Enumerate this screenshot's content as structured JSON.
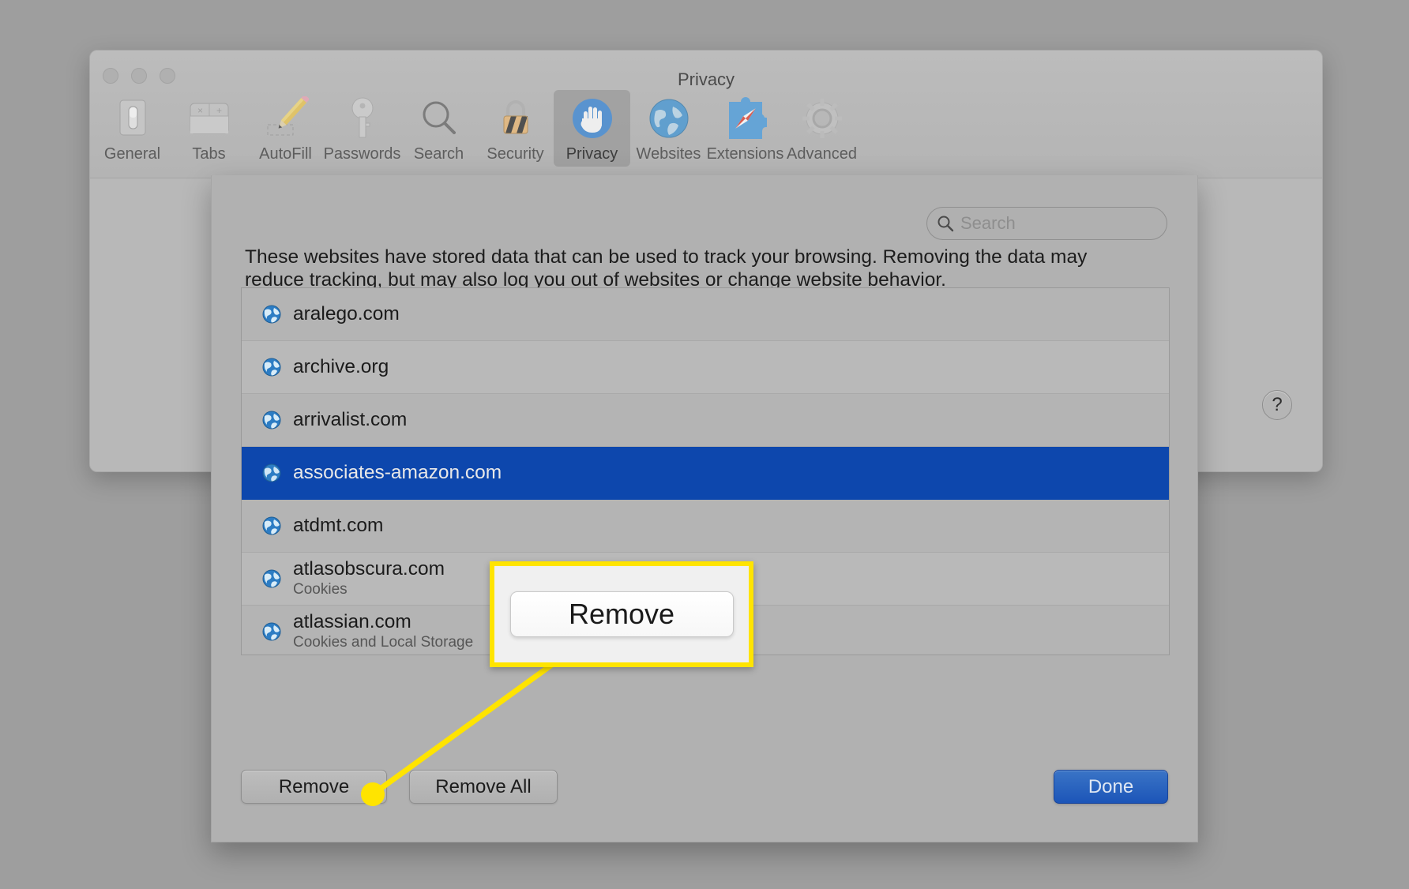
{
  "window": {
    "title": "Privacy",
    "traffic_lights": [
      "close",
      "minimize",
      "zoom"
    ],
    "help_label": "?"
  },
  "toolbar": {
    "items": [
      {
        "label": "General",
        "icon": "general-switch-icon",
        "selected": false
      },
      {
        "label": "Tabs",
        "icon": "tabs-icon",
        "selected": false
      },
      {
        "label": "AutoFill",
        "icon": "pencil-icon",
        "selected": false
      },
      {
        "label": "Passwords",
        "icon": "key-icon",
        "selected": false
      },
      {
        "label": "Search",
        "icon": "magnifier-icon",
        "selected": false
      },
      {
        "label": "Security",
        "icon": "padlock-icon",
        "selected": false
      },
      {
        "label": "Privacy",
        "icon": "hand-stop-icon",
        "selected": true
      },
      {
        "label": "Websites",
        "icon": "globe-icon",
        "selected": false
      },
      {
        "label": "Extensions",
        "icon": "puzzle-compass-icon",
        "selected": false
      },
      {
        "label": "Advanced",
        "icon": "gear-icon",
        "selected": false
      }
    ]
  },
  "sheet": {
    "search": {
      "value": "",
      "placeholder": "Search"
    },
    "description": "These websites have stored data that can be used to track your browsing. Removing the data may reduce tracking, but may also log you out of websites or change website behavior.",
    "sites": [
      {
        "name": "aralego.com",
        "detail": "",
        "selected": false
      },
      {
        "name": "archive.org",
        "detail": "",
        "selected": false
      },
      {
        "name": "arrivalist.com",
        "detail": "",
        "selected": false
      },
      {
        "name": "associates-amazon.com",
        "detail": "",
        "selected": true
      },
      {
        "name": "atdmt.com",
        "detail": "",
        "selected": false
      },
      {
        "name": "atlasobscura.com",
        "detail": "Cookies",
        "selected": false
      },
      {
        "name": "atlassian.com",
        "detail": "Cookies and Local Storage",
        "selected": false
      }
    ],
    "buttons": {
      "remove": "Remove",
      "remove_all": "Remove All",
      "done": "Done"
    }
  },
  "annotation": {
    "callout_label": "Remove",
    "highlight_color": "#ffe400",
    "selection_color": "#0d47ad"
  }
}
